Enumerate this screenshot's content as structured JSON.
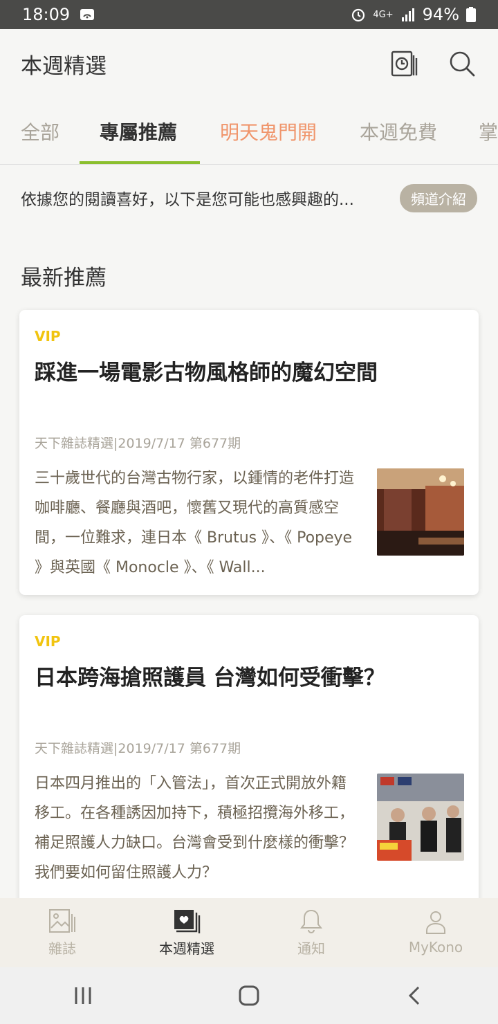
{
  "status": {
    "time": "18:09",
    "network": "4G+",
    "battery": "94%"
  },
  "appbar": {
    "title": "本週精選"
  },
  "tabs": [
    {
      "label": "全部"
    },
    {
      "label": "專屬推薦"
    },
    {
      "label": "明天鬼門開"
    },
    {
      "label": "本週免費"
    },
    {
      "label": "掌"
    }
  ],
  "intro": {
    "text": "依據您的閱讀喜好，以下是您可能也感興趣的...",
    "pill": "頻道介紹"
  },
  "section": {
    "title": "最新推薦"
  },
  "articles": [
    {
      "badge": "VIP",
      "title": "踩進一場電影古物風格師的魔幻空間",
      "meta": "天下雜誌精選|2019/7/17 第677期",
      "excerpt": "三十歲世代的台灣古物行家，以鍾情的老件打造咖啡廳、餐廳與酒吧，懷舊又現代的高質感空間，一位難求，連日本《 Brutus 》、《 Popeye 》與英國《 Monocle 》、《 Wall..."
    },
    {
      "badge": "VIP",
      "title": "日本跨海搶照護員 台灣如何受衝擊？",
      "meta": "天下雜誌精選|2019/7/17 第677期",
      "excerpt": "日本四月推出的「入管法」，首次正式開放外籍移工。在各種誘因加持下，積極招攬海外移工，補足照護人力缺口。台灣會受到什麼樣的衝擊？我們要如何留住照護人力？"
    }
  ],
  "bottom_nav": [
    {
      "label": "雜誌",
      "icon": "magazine-icon"
    },
    {
      "label": "本週精選",
      "icon": "weekly-picks-icon"
    },
    {
      "label": "通知",
      "icon": "bell-icon"
    },
    {
      "label": "MyKono",
      "icon": "user-icon"
    }
  ],
  "colors": {
    "accent": "#8bbf2e",
    "highlight_tab": "#f0956b",
    "vip": "#f1c40f"
  }
}
